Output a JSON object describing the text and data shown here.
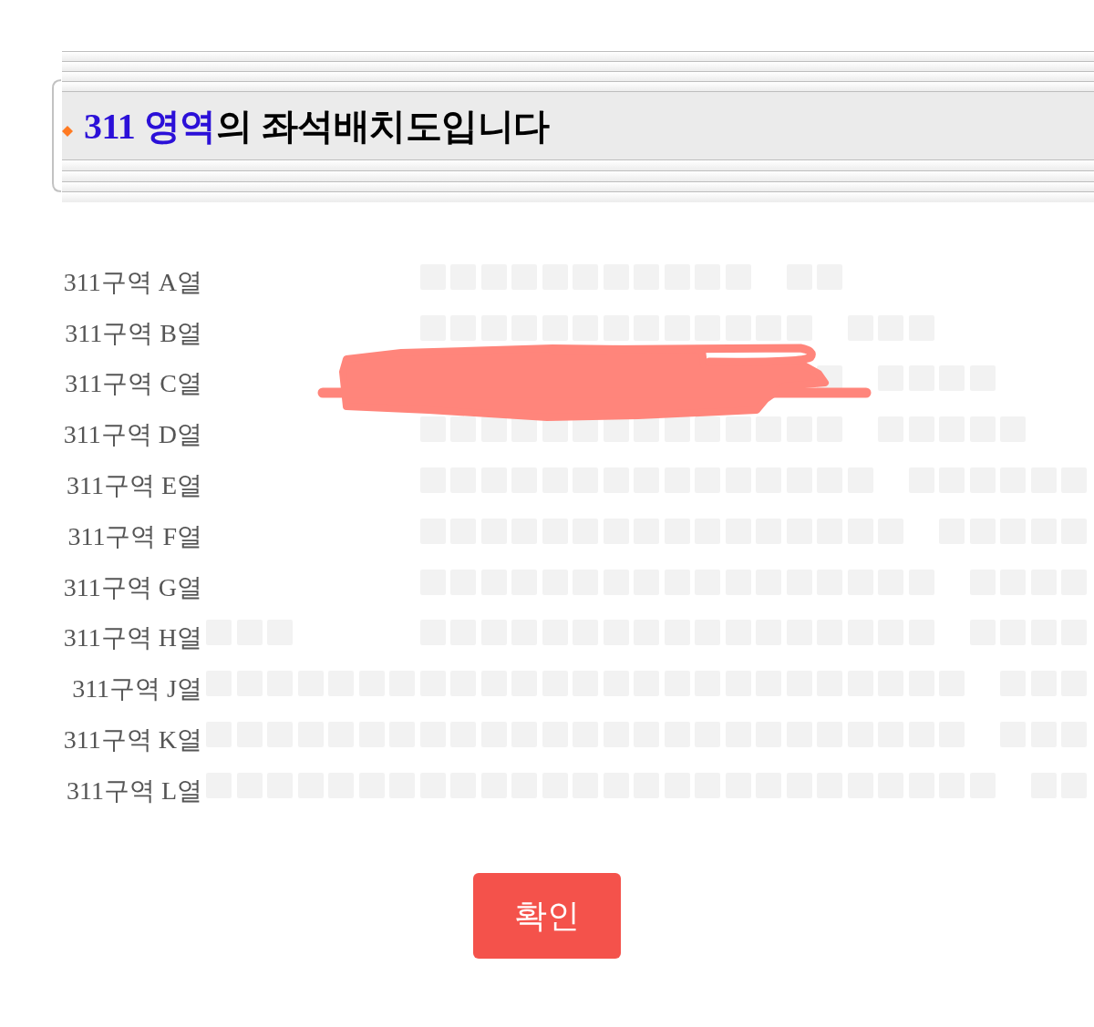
{
  "header": {
    "title_highlight": "311 영역",
    "title_rest": "의 좌석배치도입니다"
  },
  "rows": [
    {
      "label": "311구역 A열",
      "slots": [
        {
          "kind": "space"
        },
        {
          "kind": "space"
        },
        {
          "kind": "space"
        },
        {
          "kind": "space"
        },
        {
          "kind": "space"
        },
        {
          "kind": "space"
        },
        {
          "kind": "space"
        },
        {
          "kind": "seat"
        },
        {
          "kind": "seat"
        },
        {
          "kind": "seat"
        },
        {
          "kind": "seat"
        },
        {
          "kind": "seat"
        },
        {
          "kind": "seat"
        },
        {
          "kind": "seat"
        },
        {
          "kind": "seat"
        },
        {
          "kind": "seat"
        },
        {
          "kind": "seat"
        },
        {
          "kind": "seat"
        },
        {
          "kind": "space"
        },
        {
          "kind": "seat"
        },
        {
          "kind": "seat"
        }
      ]
    },
    {
      "label": "311구역 B열",
      "slots": [
        {
          "kind": "space"
        },
        {
          "kind": "space"
        },
        {
          "kind": "space"
        },
        {
          "kind": "space"
        },
        {
          "kind": "space"
        },
        {
          "kind": "space"
        },
        {
          "kind": "space"
        },
        {
          "kind": "seat"
        },
        {
          "kind": "seat"
        },
        {
          "kind": "seat"
        },
        {
          "kind": "seat"
        },
        {
          "kind": "seat"
        },
        {
          "kind": "seat"
        },
        {
          "kind": "seat"
        },
        {
          "kind": "seat"
        },
        {
          "kind": "seat"
        },
        {
          "kind": "seat"
        },
        {
          "kind": "seat"
        },
        {
          "kind": "seat"
        },
        {
          "kind": "seat"
        },
        {
          "kind": "space"
        },
        {
          "kind": "seat"
        },
        {
          "kind": "seat"
        },
        {
          "kind": "seat"
        }
      ]
    },
    {
      "label": "311구역 C열",
      "slots": [
        {
          "kind": "space"
        },
        {
          "kind": "space"
        },
        {
          "kind": "space"
        },
        {
          "kind": "space"
        },
        {
          "kind": "space"
        },
        {
          "kind": "space"
        },
        {
          "kind": "space"
        },
        {
          "kind": "space"
        },
        {
          "kind": "space"
        },
        {
          "kind": "space"
        },
        {
          "kind": "space"
        },
        {
          "kind": "space"
        },
        {
          "kind": "space"
        },
        {
          "kind": "space"
        },
        {
          "kind": "space"
        },
        {
          "kind": "space"
        },
        {
          "kind": "space"
        },
        {
          "kind": "space"
        },
        {
          "kind": "space"
        },
        {
          "kind": "space"
        },
        {
          "kind": "seat"
        },
        {
          "kind": "space"
        },
        {
          "kind": "seat"
        },
        {
          "kind": "seat"
        },
        {
          "kind": "seat"
        },
        {
          "kind": "seat"
        }
      ]
    },
    {
      "label": "311구역 D열",
      "slots": [
        {
          "kind": "space"
        },
        {
          "kind": "space"
        },
        {
          "kind": "space"
        },
        {
          "kind": "space"
        },
        {
          "kind": "space"
        },
        {
          "kind": "space"
        },
        {
          "kind": "space"
        },
        {
          "kind": "seat"
        },
        {
          "kind": "seat"
        },
        {
          "kind": "seat"
        },
        {
          "kind": "seat"
        },
        {
          "kind": "seat"
        },
        {
          "kind": "seat"
        },
        {
          "kind": "seat"
        },
        {
          "kind": "seat"
        },
        {
          "kind": "seat"
        },
        {
          "kind": "seat"
        },
        {
          "kind": "seat"
        },
        {
          "kind": "seat"
        },
        {
          "kind": "seat"
        },
        {
          "kind": "seat"
        },
        {
          "kind": "space"
        },
        {
          "kind": "seat"
        },
        {
          "kind": "seat"
        },
        {
          "kind": "seat"
        },
        {
          "kind": "seat"
        },
        {
          "kind": "seat"
        }
      ]
    },
    {
      "label": "311구역 E열",
      "slots": [
        {
          "kind": "space"
        },
        {
          "kind": "space"
        },
        {
          "kind": "space"
        },
        {
          "kind": "space"
        },
        {
          "kind": "space"
        },
        {
          "kind": "space"
        },
        {
          "kind": "space"
        },
        {
          "kind": "seat"
        },
        {
          "kind": "seat"
        },
        {
          "kind": "seat"
        },
        {
          "kind": "seat"
        },
        {
          "kind": "seat"
        },
        {
          "kind": "seat"
        },
        {
          "kind": "seat"
        },
        {
          "kind": "seat"
        },
        {
          "kind": "seat"
        },
        {
          "kind": "seat"
        },
        {
          "kind": "seat"
        },
        {
          "kind": "seat"
        },
        {
          "kind": "seat"
        },
        {
          "kind": "seat"
        },
        {
          "kind": "seat"
        },
        {
          "kind": "space"
        },
        {
          "kind": "seat"
        },
        {
          "kind": "seat"
        },
        {
          "kind": "seat"
        },
        {
          "kind": "seat"
        },
        {
          "kind": "seat"
        },
        {
          "kind": "seat"
        }
      ]
    },
    {
      "label": "311구역 F열",
      "slots": [
        {
          "kind": "space"
        },
        {
          "kind": "space"
        },
        {
          "kind": "space"
        },
        {
          "kind": "space"
        },
        {
          "kind": "space"
        },
        {
          "kind": "space"
        },
        {
          "kind": "space"
        },
        {
          "kind": "seat"
        },
        {
          "kind": "seat"
        },
        {
          "kind": "seat"
        },
        {
          "kind": "seat"
        },
        {
          "kind": "seat"
        },
        {
          "kind": "seat"
        },
        {
          "kind": "seat"
        },
        {
          "kind": "seat"
        },
        {
          "kind": "seat"
        },
        {
          "kind": "seat"
        },
        {
          "kind": "seat"
        },
        {
          "kind": "seat"
        },
        {
          "kind": "seat"
        },
        {
          "kind": "seat"
        },
        {
          "kind": "seat"
        },
        {
          "kind": "seat"
        },
        {
          "kind": "space"
        },
        {
          "kind": "seat"
        },
        {
          "kind": "seat"
        },
        {
          "kind": "seat"
        },
        {
          "kind": "seat"
        },
        {
          "kind": "seat"
        }
      ]
    },
    {
      "label": "311구역 G열",
      "slots": [
        {
          "kind": "space"
        },
        {
          "kind": "space"
        },
        {
          "kind": "space"
        },
        {
          "kind": "space"
        },
        {
          "kind": "space"
        },
        {
          "kind": "space"
        },
        {
          "kind": "space"
        },
        {
          "kind": "seat"
        },
        {
          "kind": "seat"
        },
        {
          "kind": "seat"
        },
        {
          "kind": "seat"
        },
        {
          "kind": "seat"
        },
        {
          "kind": "seat"
        },
        {
          "kind": "seat"
        },
        {
          "kind": "seat"
        },
        {
          "kind": "seat"
        },
        {
          "kind": "seat"
        },
        {
          "kind": "seat"
        },
        {
          "kind": "seat"
        },
        {
          "kind": "seat"
        },
        {
          "kind": "seat"
        },
        {
          "kind": "seat"
        },
        {
          "kind": "seat"
        },
        {
          "kind": "seat"
        },
        {
          "kind": "space"
        },
        {
          "kind": "seat"
        },
        {
          "kind": "seat"
        },
        {
          "kind": "seat"
        },
        {
          "kind": "seat"
        }
      ]
    },
    {
      "label": "311구역 H열",
      "slots": [
        {
          "kind": "seat"
        },
        {
          "kind": "seat"
        },
        {
          "kind": "seat"
        },
        {
          "kind": "space"
        },
        {
          "kind": "space"
        },
        {
          "kind": "space"
        },
        {
          "kind": "space"
        },
        {
          "kind": "seat"
        },
        {
          "kind": "seat"
        },
        {
          "kind": "seat"
        },
        {
          "kind": "seat"
        },
        {
          "kind": "seat"
        },
        {
          "kind": "seat"
        },
        {
          "kind": "seat"
        },
        {
          "kind": "seat"
        },
        {
          "kind": "seat"
        },
        {
          "kind": "seat"
        },
        {
          "kind": "seat"
        },
        {
          "kind": "seat"
        },
        {
          "kind": "seat"
        },
        {
          "kind": "seat"
        },
        {
          "kind": "seat"
        },
        {
          "kind": "seat"
        },
        {
          "kind": "seat"
        },
        {
          "kind": "space"
        },
        {
          "kind": "seat"
        },
        {
          "kind": "seat"
        },
        {
          "kind": "seat"
        },
        {
          "kind": "seat"
        }
      ]
    },
    {
      "label": "311구역 J열",
      "slots": [
        {
          "kind": "seat"
        },
        {
          "kind": "seat"
        },
        {
          "kind": "seat"
        },
        {
          "kind": "seat"
        },
        {
          "kind": "seat"
        },
        {
          "kind": "seat"
        },
        {
          "kind": "seat"
        },
        {
          "kind": "seat"
        },
        {
          "kind": "seat"
        },
        {
          "kind": "seat"
        },
        {
          "kind": "seat"
        },
        {
          "kind": "seat"
        },
        {
          "kind": "seat"
        },
        {
          "kind": "seat"
        },
        {
          "kind": "seat"
        },
        {
          "kind": "seat"
        },
        {
          "kind": "seat"
        },
        {
          "kind": "seat"
        },
        {
          "kind": "seat"
        },
        {
          "kind": "seat"
        },
        {
          "kind": "seat"
        },
        {
          "kind": "seat"
        },
        {
          "kind": "seat"
        },
        {
          "kind": "seat"
        },
        {
          "kind": "seat"
        },
        {
          "kind": "space"
        },
        {
          "kind": "seat"
        },
        {
          "kind": "seat"
        },
        {
          "kind": "seat"
        }
      ]
    },
    {
      "label": "311구역 K열",
      "slots": [
        {
          "kind": "seat"
        },
        {
          "kind": "seat"
        },
        {
          "kind": "seat"
        },
        {
          "kind": "seat"
        },
        {
          "kind": "seat"
        },
        {
          "kind": "seat"
        },
        {
          "kind": "seat"
        },
        {
          "kind": "seat"
        },
        {
          "kind": "seat"
        },
        {
          "kind": "seat"
        },
        {
          "kind": "seat"
        },
        {
          "kind": "seat"
        },
        {
          "kind": "seat"
        },
        {
          "kind": "seat"
        },
        {
          "kind": "seat"
        },
        {
          "kind": "seat"
        },
        {
          "kind": "seat"
        },
        {
          "kind": "seat"
        },
        {
          "kind": "seat"
        },
        {
          "kind": "seat"
        },
        {
          "kind": "seat"
        },
        {
          "kind": "seat"
        },
        {
          "kind": "seat"
        },
        {
          "kind": "seat"
        },
        {
          "kind": "seat"
        },
        {
          "kind": "space"
        },
        {
          "kind": "seat"
        },
        {
          "kind": "seat"
        },
        {
          "kind": "seat"
        }
      ]
    },
    {
      "label": "311구역 L열",
      "slots": [
        {
          "kind": "seat"
        },
        {
          "kind": "seat"
        },
        {
          "kind": "seat"
        },
        {
          "kind": "seat"
        },
        {
          "kind": "seat"
        },
        {
          "kind": "seat"
        },
        {
          "kind": "seat"
        },
        {
          "kind": "seat"
        },
        {
          "kind": "seat"
        },
        {
          "kind": "seat"
        },
        {
          "kind": "seat"
        },
        {
          "kind": "seat"
        },
        {
          "kind": "seat"
        },
        {
          "kind": "seat"
        },
        {
          "kind": "seat"
        },
        {
          "kind": "seat"
        },
        {
          "kind": "seat"
        },
        {
          "kind": "seat"
        },
        {
          "kind": "seat"
        },
        {
          "kind": "seat"
        },
        {
          "kind": "seat"
        },
        {
          "kind": "seat"
        },
        {
          "kind": "seat"
        },
        {
          "kind": "seat"
        },
        {
          "kind": "seat"
        },
        {
          "kind": "seat"
        },
        {
          "kind": "space"
        },
        {
          "kind": "seat"
        },
        {
          "kind": "seat"
        }
      ]
    }
  ],
  "redaction_mark": true,
  "button": {
    "label": "확인"
  }
}
